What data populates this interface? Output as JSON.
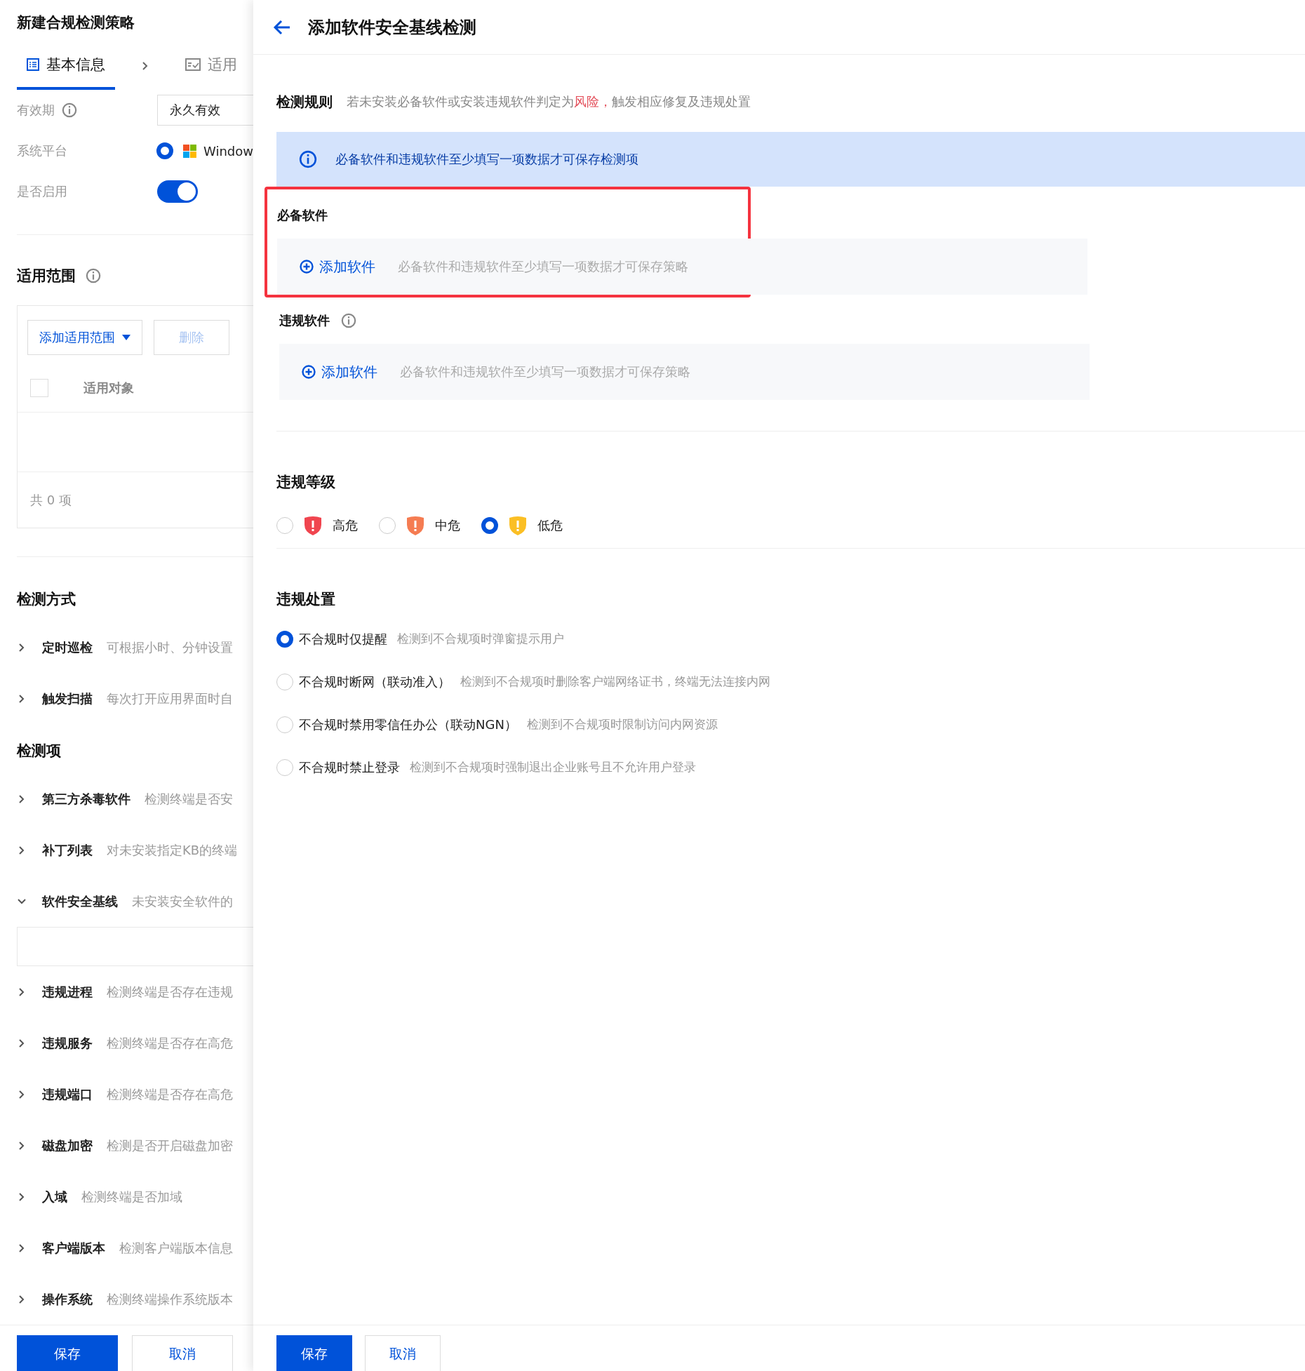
{
  "left_panel": {
    "title": "新建合规检测策略",
    "tabs": [
      {
        "label": "基本信息",
        "selected": true
      },
      {
        "label": "适用",
        "selected": false
      }
    ],
    "validity": {
      "label": "有效期",
      "value": "永久有效"
    },
    "platform": {
      "label": "系统平台",
      "option": "Window",
      "selected": true
    },
    "enabled": {
      "label": "是否启用",
      "on": true
    },
    "scope": {
      "title": "适用范围",
      "add_button": "添加适用范围",
      "delete_button": "删除",
      "delete_disabled": true,
      "column": "适用对象",
      "checked": false,
      "total": "共 0 项"
    },
    "detection_method": {
      "title": "检测方式",
      "items": [
        {
          "name": "定时巡检",
          "description": "可根据小时、分钟设置",
          "expanded": false
        },
        {
          "name": "触发扫描",
          "description": "每次打开应用界面时自",
          "expanded": false
        }
      ]
    },
    "detection_items": {
      "title": "检测项",
      "items": [
        {
          "name": "第三方杀毒软件",
          "description": "检测终端是否安",
          "expanded": false
        },
        {
          "name": "补丁列表",
          "description": "对未安装指定KB的终端",
          "expanded": false
        },
        {
          "name": "软件安全基线",
          "description": "未安装安全软件的",
          "expanded": true
        },
        {
          "name": "违规进程",
          "description": "检测终端是否存在违规",
          "expanded": false
        },
        {
          "name": "违规服务",
          "description": "检测终端是否存在高危",
          "expanded": false
        },
        {
          "name": "违规端口",
          "description": "检测终端是否存在高危",
          "expanded": false
        },
        {
          "name": "磁盘加密",
          "description": "检测是否开启磁盘加密",
          "expanded": false
        },
        {
          "name": "入域",
          "description": "检测终端是否加域",
          "expanded": false
        },
        {
          "name": "客户端版本",
          "description": "检测客户端版本信息",
          "expanded": false
        },
        {
          "name": "操作系统",
          "description": "检测终端操作系统版本",
          "expanded": false
        }
      ]
    },
    "buttons": {
      "save": "保存",
      "cancel": "取消"
    }
  },
  "right_panel": {
    "title": "添加软件安全基线检测",
    "rule": {
      "label": "检测规则",
      "text_before": "若未安装必备软件或安装违规软件判定为",
      "highlight": "风险，",
      "text_after": "触发相应修复及违规处置"
    },
    "notice": "必备软件和违规软件至少填写一项数据才可保存检测项",
    "required_software": {
      "title": "必备软件",
      "add_label": "添加软件",
      "hint": "必备软件和违规软件至少填写一项数据才可保存策略",
      "highlighted": true
    },
    "violating_software": {
      "title": "违规软件",
      "add_label": "添加软件",
      "hint": "必备软件和违规软件至少填写一项数据才可保存策略",
      "highlighted": false
    },
    "level": {
      "title": "违规等级",
      "options": [
        {
          "label": "高危",
          "color": "#f0454f",
          "selected": false
        },
        {
          "label": "中危",
          "color": "#f57c52",
          "selected": false
        },
        {
          "label": "低危",
          "color": "#fbbf24",
          "selected": true
        }
      ]
    },
    "action": {
      "title": "违规处置",
      "options": [
        {
          "label": "不合规时仅提醒",
          "description": "检测到不合规项时弹窗提示用户",
          "selected": true
        },
        {
          "label": "不合规时断网（联动准入）",
          "description": "检测到不合规项时删除客户端网络证书，终端无法连接内网",
          "selected": false
        },
        {
          "label": "不合规时禁用零信任办公（联动NGN）",
          "description": "检测到不合规项时限制访问内网资源",
          "selected": false
        },
        {
          "label": "不合规时禁止登录",
          "description": "检测到不合规项时强制退出企业账号且不允许用户登录",
          "selected": false
        }
      ]
    },
    "buttons": {
      "save": "保存",
      "cancel": "取消"
    }
  }
}
